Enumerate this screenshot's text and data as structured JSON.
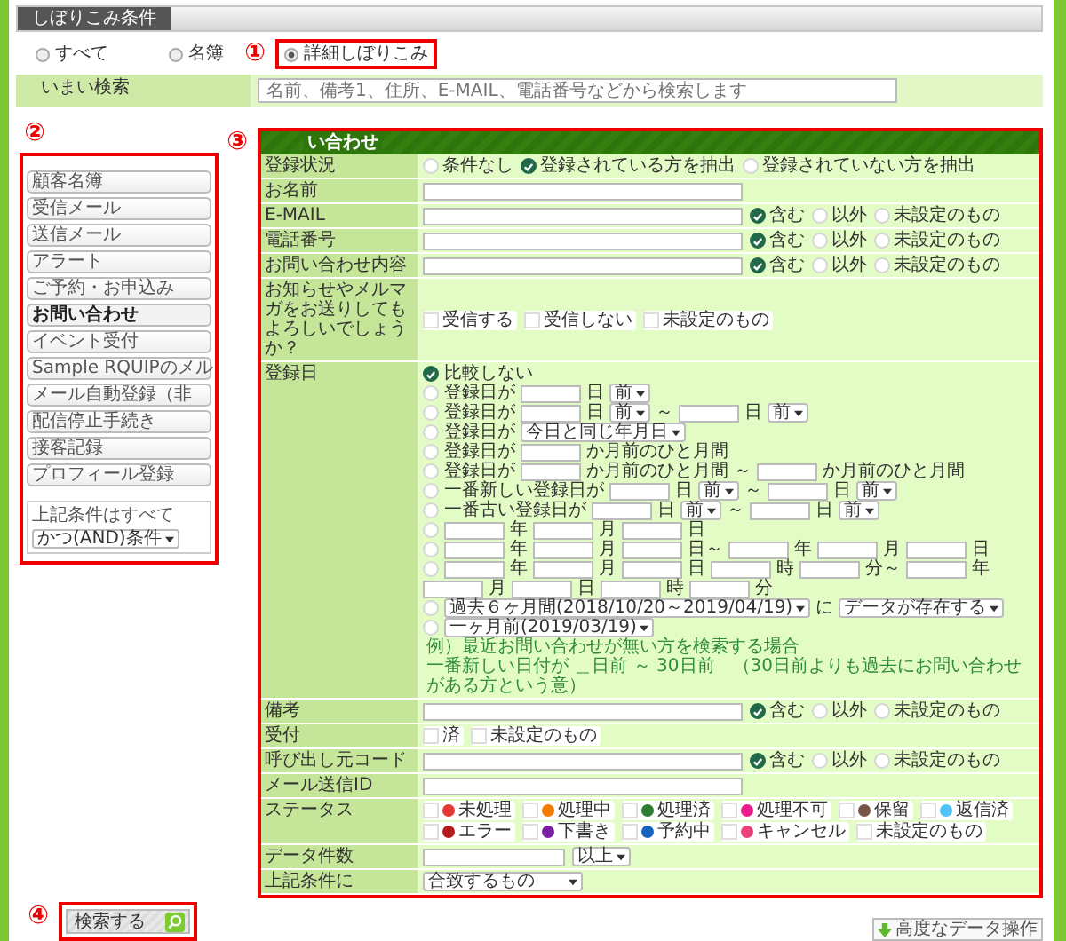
{
  "panel": {
    "title": "しぼりこみ条件"
  },
  "modes": [
    {
      "label": "すべて",
      "selected": false
    },
    {
      "label": "名簿",
      "selected": false
    },
    {
      "label": "詳細しぼりこみ",
      "selected": true,
      "callout": "①"
    }
  ],
  "fuzzy": {
    "label": "いまい検索",
    "placeholder": "名前、備考1、住所、E-MAIL、電話番号などから検索します"
  },
  "sidebar": {
    "callout": "②",
    "items": [
      {
        "label": "顧客名簿",
        "selected": false
      },
      {
        "label": "受信メール",
        "selected": false
      },
      {
        "label": "送信メール",
        "selected": false
      },
      {
        "label": "アラート",
        "selected": false
      },
      {
        "label": "ご予約・お申込み",
        "selected": false
      },
      {
        "label": "お問い合わせ",
        "selected": true
      },
      {
        "label": "イベント受付",
        "selected": false
      },
      {
        "label": "Sample RQUIPのメル",
        "selected": false
      },
      {
        "label": "メール自動登録（非",
        "selected": false
      },
      {
        "label": "配信停止手続き",
        "selected": false
      },
      {
        "label": "接客記録",
        "selected": false
      },
      {
        "label": "プロフィール登録",
        "selected": false
      }
    ],
    "combine_label": "上記条件はすべて",
    "combine_value": "かつ(AND)条件"
  },
  "form": {
    "callout": "③",
    "title": "い合わせ",
    "rows": [
      {
        "kind": "radios",
        "label": "登録状況",
        "options": [
          {
            "label": "条件なし",
            "selected": false
          },
          {
            "label": "登録されている方を抽出",
            "selected": true
          },
          {
            "label": "登録されていない方を抽出",
            "selected": false
          }
        ]
      },
      {
        "kind": "input",
        "label": "お名前"
      },
      {
        "kind": "match",
        "label": "E-MAIL",
        "options": [
          {
            "label": "含む",
            "selected": true
          },
          {
            "label": "以外",
            "selected": false
          },
          {
            "label": "未設定のもの",
            "selected": false
          }
        ]
      },
      {
        "kind": "match",
        "label": "電話番号",
        "options": [
          {
            "label": "含む",
            "selected": true
          },
          {
            "label": "以外",
            "selected": false
          },
          {
            "label": "未設定のもの",
            "selected": false
          }
        ]
      },
      {
        "kind": "match",
        "label": "お問い合わせ内容",
        "options": [
          {
            "label": "含む",
            "selected": true
          },
          {
            "label": "以外",
            "selected": false
          },
          {
            "label": "未設定のもの",
            "selected": false
          }
        ]
      },
      {
        "kind": "checks",
        "label": "お知らせやメルマガをお送りしてもよろしいでしょうか？",
        "options": [
          {
            "label": "受信する",
            "checked": false
          },
          {
            "label": "受信しない",
            "checked": false
          },
          {
            "label": "未設定のもの",
            "checked": false
          }
        ]
      },
      {
        "kind": "date",
        "label": "登録日",
        "conditions": [
          {
            "selected": true,
            "parts": [
              {
                "kind": "text",
                "text": "比較しない"
              }
            ]
          },
          {
            "selected": false,
            "parts": [
              {
                "kind": "text",
                "text": "登録日が"
              },
              {
                "kind": "input"
              },
              {
                "kind": "text",
                "text": "日"
              },
              {
                "kind": "select",
                "value": "前"
              }
            ]
          },
          {
            "selected": false,
            "parts": [
              {
                "kind": "text",
                "text": "登録日が"
              },
              {
                "kind": "input"
              },
              {
                "kind": "text",
                "text": "日"
              },
              {
                "kind": "select",
                "value": "前"
              },
              {
                "kind": "text",
                "text": "～"
              },
              {
                "kind": "input"
              },
              {
                "kind": "text",
                "text": "日"
              },
              {
                "kind": "select",
                "value": "前"
              }
            ]
          },
          {
            "selected": false,
            "parts": [
              {
                "kind": "text",
                "text": "登録日が"
              },
              {
                "kind": "select",
                "value": "今日と同じ年月日"
              }
            ]
          },
          {
            "selected": false,
            "parts": [
              {
                "kind": "text",
                "text": "登録日が"
              },
              {
                "kind": "input"
              },
              {
                "kind": "text",
                "text": "か月前のひと月間"
              }
            ]
          },
          {
            "selected": false,
            "parts": [
              {
                "kind": "text",
                "text": "登録日が"
              },
              {
                "kind": "input"
              },
              {
                "kind": "text",
                "text": "か月前のひと月間"
              },
              {
                "kind": "text",
                "text": "～"
              },
              {
                "kind": "input"
              },
              {
                "kind": "text",
                "text": "か月前のひと月間"
              }
            ]
          },
          {
            "selected": false,
            "parts": [
              {
                "kind": "text",
                "text": "一番新しい登録日が"
              },
              {
                "kind": "input"
              },
              {
                "kind": "text",
                "text": "日"
              },
              {
                "kind": "select",
                "value": "前"
              },
              {
                "kind": "text",
                "text": "～"
              },
              {
                "kind": "input"
              },
              {
                "kind": "text",
                "text": "日"
              },
              {
                "kind": "select",
                "value": "前"
              }
            ]
          },
          {
            "selected": false,
            "parts": [
              {
                "kind": "text",
                "text": "一番古い登録日が"
              },
              {
                "kind": "input"
              },
              {
                "kind": "text",
                "text": "日"
              },
              {
                "kind": "select",
                "value": "前"
              },
              {
                "kind": "text",
                "text": "～"
              },
              {
                "kind": "input"
              },
              {
                "kind": "text",
                "text": "日"
              },
              {
                "kind": "select",
                "value": "前"
              }
            ]
          },
          {
            "selected": false,
            "parts": [
              {
                "kind": "input"
              },
              {
                "kind": "text",
                "text": "年"
              },
              {
                "kind": "input"
              },
              {
                "kind": "text",
                "text": "月"
              },
              {
                "kind": "input"
              },
              {
                "kind": "text",
                "text": "日"
              }
            ]
          },
          {
            "selected": false,
            "parts": [
              {
                "kind": "input"
              },
              {
                "kind": "text",
                "text": "年"
              },
              {
                "kind": "input"
              },
              {
                "kind": "text",
                "text": "月"
              },
              {
                "kind": "input"
              },
              {
                "kind": "text",
                "text": "日～"
              },
              {
                "kind": "input"
              },
              {
                "kind": "text",
                "text": "年"
              },
              {
                "kind": "input"
              },
              {
                "kind": "text",
                "text": "月"
              },
              {
                "kind": "input"
              },
              {
                "kind": "text",
                "text": "日"
              }
            ]
          },
          {
            "selected": false,
            "parts": [
              {
                "kind": "input"
              },
              {
                "kind": "text",
                "text": "年"
              },
              {
                "kind": "input"
              },
              {
                "kind": "text",
                "text": "月"
              },
              {
                "kind": "input"
              },
              {
                "kind": "text",
                "text": "日"
              },
              {
                "kind": "input"
              },
              {
                "kind": "text",
                "text": "時"
              },
              {
                "kind": "input"
              },
              {
                "kind": "text",
                "text": "分～"
              },
              {
                "kind": "input"
              },
              {
                "kind": "text",
                "text": "年"
              },
              {
                "kind": "input"
              },
              {
                "kind": "text",
                "text": "月"
              },
              {
                "kind": "input"
              },
              {
                "kind": "text",
                "text": "日"
              },
              {
                "kind": "input"
              },
              {
                "kind": "text",
                "text": "時"
              },
              {
                "kind": "input"
              },
              {
                "kind": "text",
                "text": "分"
              }
            ]
          },
          {
            "selected": false,
            "parts": [
              {
                "kind": "select",
                "value": "過去６ヶ月間(2018/10/20～2019/04/19)"
              },
              {
                "kind": "text",
                "text": "に"
              },
              {
                "kind": "select",
                "value": "データが存在する"
              }
            ]
          },
          {
            "selected": false,
            "parts": [
              {
                "kind": "select",
                "value": "一ヶ月前(2019/03/19)"
              }
            ]
          }
        ],
        "notes": [
          "例）最近お問い合わせが無い方を検索する場合",
          "一番新しい日付が ＿日前 ～ 30日前　（30日前よりも過去にお問い合わせがある方という意）"
        ]
      },
      {
        "kind": "match",
        "label": "備考",
        "options": [
          {
            "label": "含む",
            "selected": true
          },
          {
            "label": "以外",
            "selected": false
          },
          {
            "label": "未設定のもの",
            "selected": false
          }
        ]
      },
      {
        "kind": "checks",
        "label": "受付",
        "options": [
          {
            "label": "済",
            "checked": false
          },
          {
            "label": "未設定のもの",
            "checked": false
          }
        ]
      },
      {
        "kind": "match",
        "label": "呼び出し元コード",
        "options": [
          {
            "label": "含む",
            "selected": true
          },
          {
            "label": "以外",
            "selected": false
          },
          {
            "label": "未設定のもの",
            "selected": false
          }
        ]
      },
      {
        "kind": "input",
        "label": "メール送信ID"
      },
      {
        "kind": "status",
        "label": "ステータス",
        "options": [
          {
            "label": "未処理",
            "checked": false,
            "color": "#e53935"
          },
          {
            "label": "処理中",
            "checked": false,
            "color": "#f57c00"
          },
          {
            "label": "処理済",
            "checked": false,
            "color": "#2e7d32"
          },
          {
            "label": "処理不可",
            "checked": false,
            "color": "#e91e8c"
          },
          {
            "label": "保留",
            "checked": false,
            "color": "#795548"
          },
          {
            "label": "返信済",
            "checked": false,
            "color": "#4fc3f7"
          },
          {
            "label": "エラー",
            "checked": false,
            "color": "#b71c1c"
          },
          {
            "label": "下書き",
            "checked": false,
            "color": "#7b1fa2"
          },
          {
            "label": "予約中",
            "checked": false,
            "color": "#1565c0"
          },
          {
            "label": "キャンセル",
            "checked": false,
            "color": "#ec407a"
          },
          {
            "label": "未設定のもの",
            "checked": false
          }
        ]
      },
      {
        "kind": "count",
        "label": "データ件数",
        "unit": "以上"
      },
      {
        "kind": "select",
        "label": "上記条件に",
        "value": "合致するもの"
      }
    ]
  },
  "search_button": {
    "label": "検索する",
    "callout": "④"
  },
  "advanced_button": {
    "label": "高度なデータ操作"
  }
}
